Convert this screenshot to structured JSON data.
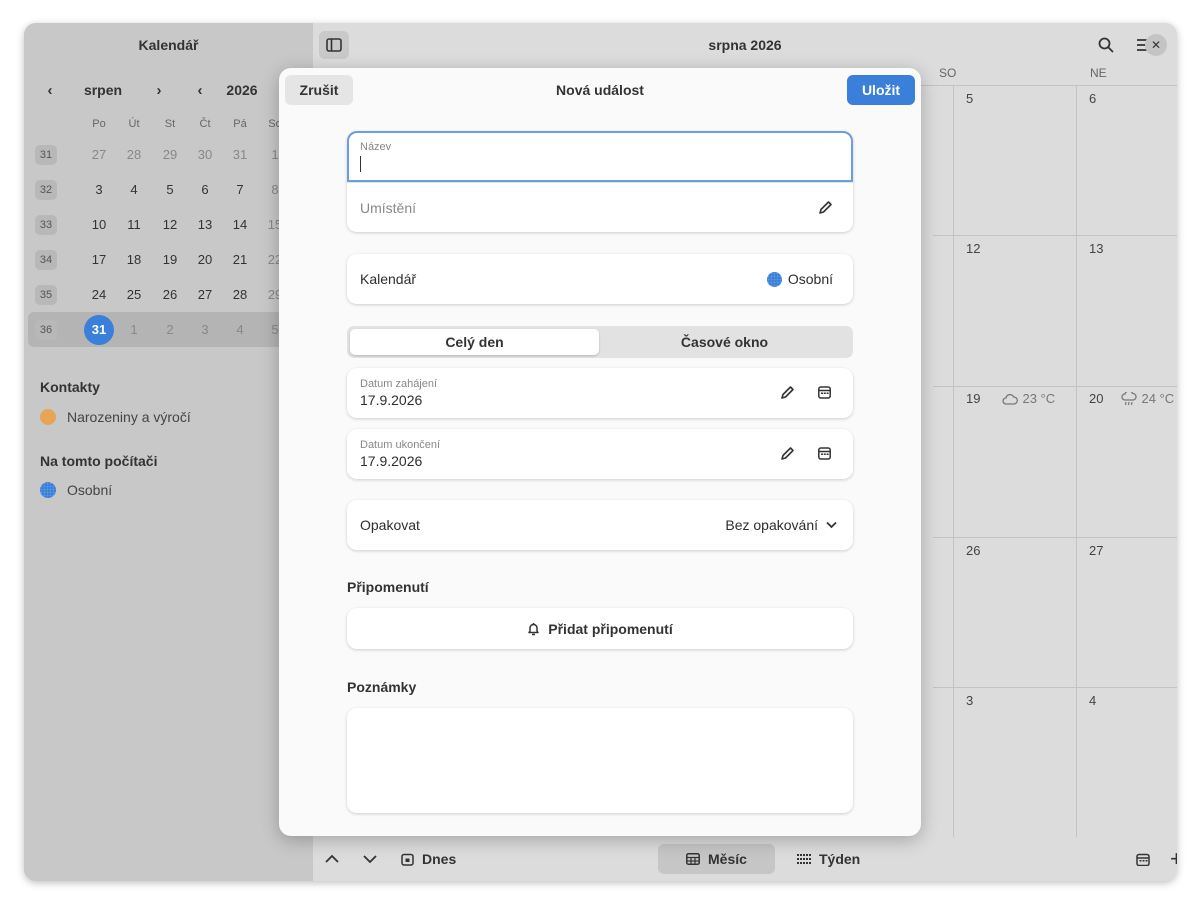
{
  "sidebar": {
    "title": "Kalendář",
    "month": "srpen",
    "year": "2026",
    "weekday_headers": [
      "Po",
      "Út",
      "St",
      "Čt",
      "Pá",
      "So"
    ],
    "weeks": [
      {
        "num": "31",
        "days": [
          "27",
          "28",
          "29",
          "30",
          "31",
          "1"
        ]
      },
      {
        "num": "32",
        "days": [
          "3",
          "4",
          "5",
          "6",
          "7",
          "8"
        ]
      },
      {
        "num": "33",
        "days": [
          "10",
          "11",
          "12",
          "13",
          "14",
          "15"
        ]
      },
      {
        "num": "34",
        "days": [
          "17",
          "18",
          "19",
          "20",
          "21",
          "22"
        ]
      },
      {
        "num": "35",
        "days": [
          "24",
          "25",
          "26",
          "27",
          "28",
          "29"
        ]
      },
      {
        "num": "36",
        "days": [
          "31",
          "1",
          "2",
          "3",
          "4",
          "5"
        ]
      }
    ],
    "sections": {
      "contacts_title": "Kontakty",
      "contacts_item": "Narozeniny a výročí",
      "local_title": "Na tomto počítači",
      "local_item": "Osobní"
    }
  },
  "main": {
    "title": "srpna 2026",
    "day_headers": [
      "SO",
      "NE"
    ],
    "days_col1": [
      "5",
      "12",
      "19",
      "26",
      "3"
    ],
    "days_col2": [
      "6",
      "13",
      "20",
      "27",
      "4"
    ],
    "weather_19": "23 °C",
    "weather_20": "24 °C"
  },
  "bottom": {
    "today": "Dnes",
    "month": "Měsíc",
    "week": "Týden"
  },
  "dialog": {
    "cancel": "Zrušit",
    "title": "Nová událost",
    "save": "Uložit",
    "name_label": "Název",
    "location_placeholder": "Umístění",
    "calendar_label": "Kalendář",
    "calendar_value": "Osobní",
    "seg_all_day": "Celý den",
    "seg_time_slot": "Časové okno",
    "start_label": "Datum zahájení",
    "start_value": "17.9.2026",
    "end_label": "Datum ukončení",
    "end_value": "17.9.2026",
    "repeat_label": "Opakovat",
    "repeat_value": "Bez opakování",
    "reminders_title": "Připomenutí",
    "add_reminder": "Přidat připomenutí",
    "notes_title": "Poznámky"
  },
  "colors": {
    "accent": "#3a7fd9",
    "birthday": "#e6a556"
  }
}
